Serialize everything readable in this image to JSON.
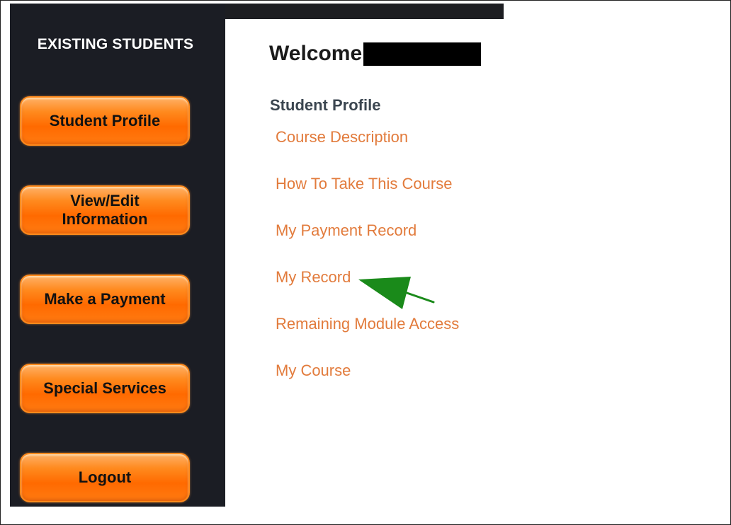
{
  "sidebar": {
    "heading": "EXISTING STUDENTS",
    "buttons": [
      {
        "label": "Student Profile"
      },
      {
        "label": "View/Edit\nInformation"
      },
      {
        "label": "Make a Payment"
      },
      {
        "label": "Special Services"
      },
      {
        "label": "Logout"
      }
    ]
  },
  "main": {
    "welcome": "Welcome",
    "section_title": "Student Profile",
    "links": [
      {
        "label": "Course Description"
      },
      {
        "label": "How To Take This Course"
      },
      {
        "label": "My Payment Record"
      },
      {
        "label": "My Record"
      },
      {
        "label": "Remaining Module Access"
      },
      {
        "label": "My Course"
      }
    ]
  },
  "annotation": {
    "arrow_color": "#1a8a1a",
    "arrow_target": "My Record"
  },
  "colors": {
    "sidebar_bg": "#1b1d24",
    "button_orange": "#ff6a00",
    "link_orange": "#e27b3c"
  }
}
